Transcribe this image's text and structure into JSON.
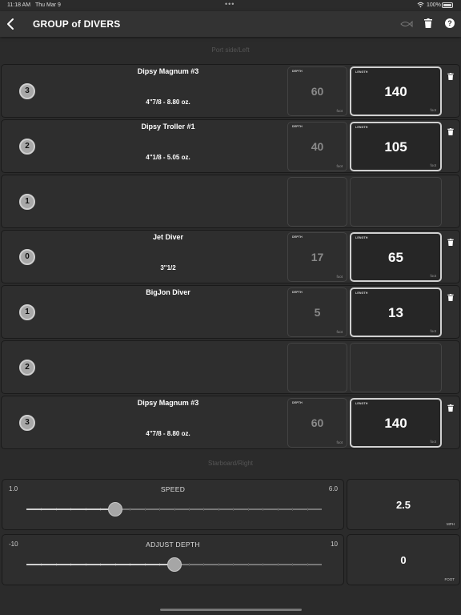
{
  "status_bar": {
    "time": "11:18 AM",
    "date": "Thu Mar 9",
    "dots": "•••",
    "battery": "100%"
  },
  "nav": {
    "title": "GROUP of DIVERS",
    "icons": [
      "chevron-left-icon",
      "fish-icon",
      "trash-icon",
      "help-icon"
    ]
  },
  "sections": {
    "port": "Port side/Left",
    "starboard": "Starboard/Right"
  },
  "box_labels": {
    "depth": "DEPTH",
    "length": "LENGTH",
    "unit": "foot"
  },
  "rows": [
    {
      "position": "3",
      "name": "Dipsy Magnum #3",
      "spec": "4''7/8 - 8.80 oz.",
      "depth": "60",
      "length": "140",
      "filled": true
    },
    {
      "position": "2",
      "name": "Dipsy Troller #1",
      "spec": "4''1/8 - 5.05 oz.",
      "depth": "40",
      "length": "105",
      "filled": true
    },
    {
      "position": "1",
      "name": "",
      "spec": "",
      "depth": "",
      "length": "",
      "filled": false
    },
    {
      "position": "0",
      "name": "Jet Diver",
      "spec": "3''1/2",
      "depth": "17",
      "length": "65",
      "filled": true
    },
    {
      "position": "1",
      "name": "BigJon Diver",
      "spec": "",
      "depth": "5",
      "length": "13",
      "filled": true
    },
    {
      "position": "2",
      "name": "",
      "spec": "",
      "depth": "",
      "length": "",
      "filled": false
    },
    {
      "position": "3",
      "name": "Dipsy Magnum #3",
      "spec": "4''7/8 - 8.80 oz.",
      "depth": "60",
      "length": "140",
      "filled": true
    }
  ],
  "speed": {
    "title": "SPEED",
    "min": "1.0",
    "max": "6.0",
    "min_value": 1.0,
    "max_value": 6.0,
    "value": 2.5,
    "value_text": "2.5",
    "unit": "MPH"
  },
  "adjust_depth": {
    "title": "ADJUST DEPTH",
    "min": "-10",
    "max": "10",
    "min_value": -10,
    "max_value": 10,
    "value": 0,
    "value_text": "0",
    "unit": "FOOT"
  }
}
